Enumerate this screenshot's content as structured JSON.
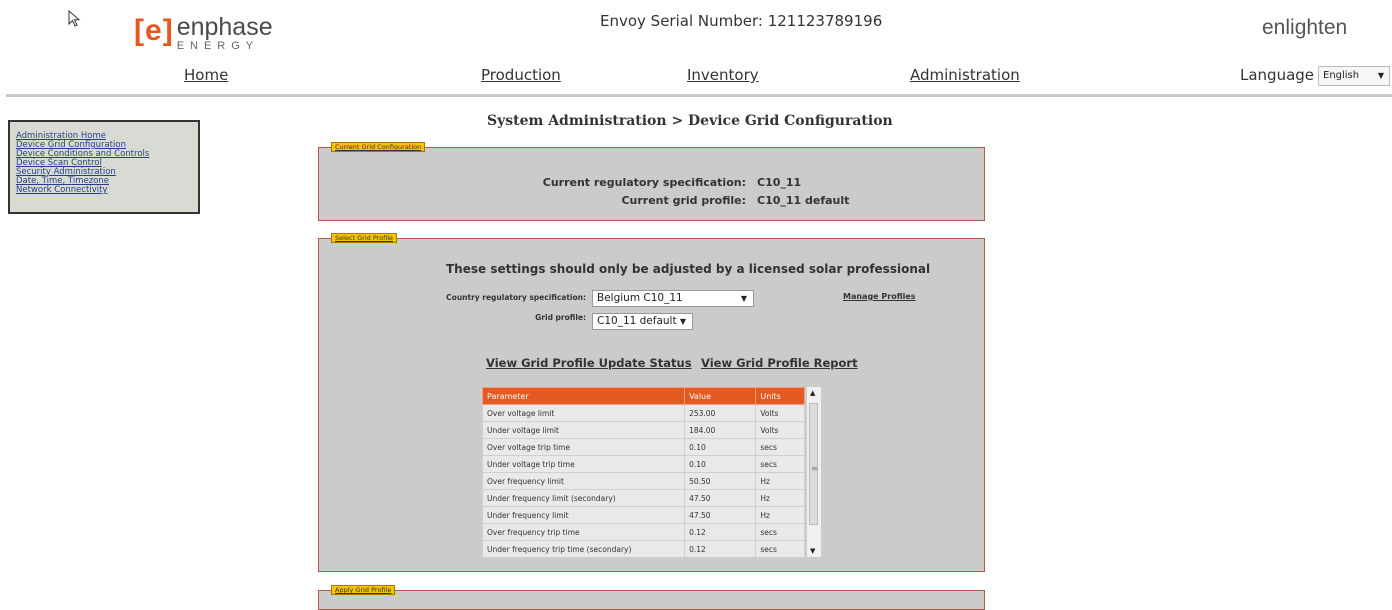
{
  "header": {
    "logo_bracket_open": "[",
    "logo_e": "e",
    "logo_bracket_close": "]",
    "logo_word": "enphase",
    "logo_sub": "ENERGY",
    "serial": "Envoy Serial Number: 121123789196",
    "brand_right": "enlighten"
  },
  "nav": {
    "items": [
      "Home",
      "Production",
      "Inventory",
      "Administration"
    ],
    "language_label": "Language",
    "language_value": "English"
  },
  "sidebar": {
    "items": [
      "Administration Home",
      "Device Grid Configuration",
      "Device Conditions and Controls",
      "Device Scan Control",
      "Security Administration",
      "Date, Time, Timezone",
      "Network Connectivity"
    ]
  },
  "page_title": "System Administration > Device Grid Configuration",
  "current_config": {
    "legend": "Current Grid Configuration",
    "spec_label": "Current regulatory specification:",
    "spec_value": "C10_11",
    "profile_label": "Current grid profile:",
    "profile_value": "C10_11 default"
  },
  "select_profile": {
    "legend": "Select Grid Profile",
    "warning": "These settings should only be adjusted by a licensed solar professional",
    "country_label": "Country regulatory specification:",
    "country_value": "Belgium C10_11",
    "grid_label": "Grid profile:",
    "grid_value": "C10_11 default",
    "manage_link": "Manage Profiles",
    "status_link": "View Grid Profile Update Status",
    "report_link": "View Grid Profile Report"
  },
  "table": {
    "headers": [
      "Parameter",
      "Value",
      "Units"
    ],
    "rows": [
      [
        "Over voltage limit",
        "253.00",
        "Volts"
      ],
      [
        "Under voltage limit",
        "184.00",
        "Volts"
      ],
      [
        "Over voltage trip time",
        "0.10",
        "secs"
      ],
      [
        "Under voltage trip time",
        "0.10",
        "secs"
      ],
      [
        "Over frequency limit",
        "50.50",
        "Hz"
      ],
      [
        "Under frequency limit (secondary)",
        "47.50",
        "Hz"
      ],
      [
        "Under frequency limit",
        "47.50",
        "Hz"
      ],
      [
        "Over frequency trip time",
        "0.12",
        "secs"
      ],
      [
        "Under frequency trip time (secondary)",
        "0.12",
        "secs"
      ]
    ]
  },
  "apply_profile": {
    "legend": "Apply Grid Profile"
  },
  "colors": {
    "accent": "#e25a21",
    "legend": "#f5c400",
    "panel": "#cbcbcb"
  }
}
